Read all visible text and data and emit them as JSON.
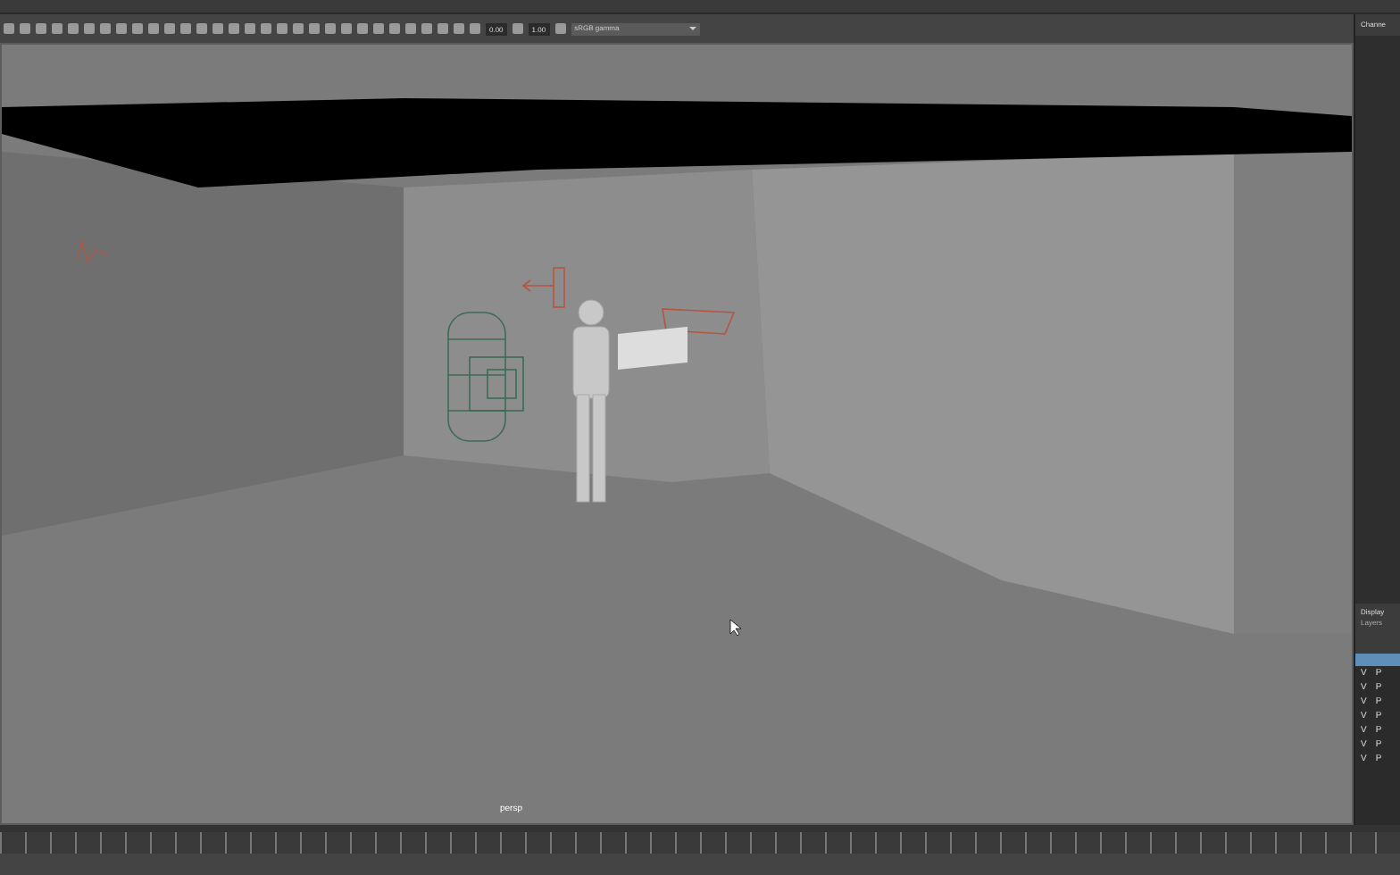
{
  "toolbar": {
    "exposure": "0.00",
    "gamma": "1.00",
    "color_space": "sRGB gamma"
  },
  "viewport": {
    "camera": "persp"
  },
  "channel_box": {
    "title": "Channe"
  },
  "layer_editor": {
    "title": "Display",
    "tab": "Layers",
    "layers": [
      {
        "visible": "V",
        "playback": "P"
      },
      {
        "visible": "V",
        "playback": "P"
      },
      {
        "visible": "V",
        "playback": "P"
      },
      {
        "visible": "V",
        "playback": "P"
      },
      {
        "visible": "V",
        "playback": "P"
      },
      {
        "visible": "V",
        "playback": "P"
      },
      {
        "visible": "V",
        "playback": "P"
      }
    ]
  }
}
